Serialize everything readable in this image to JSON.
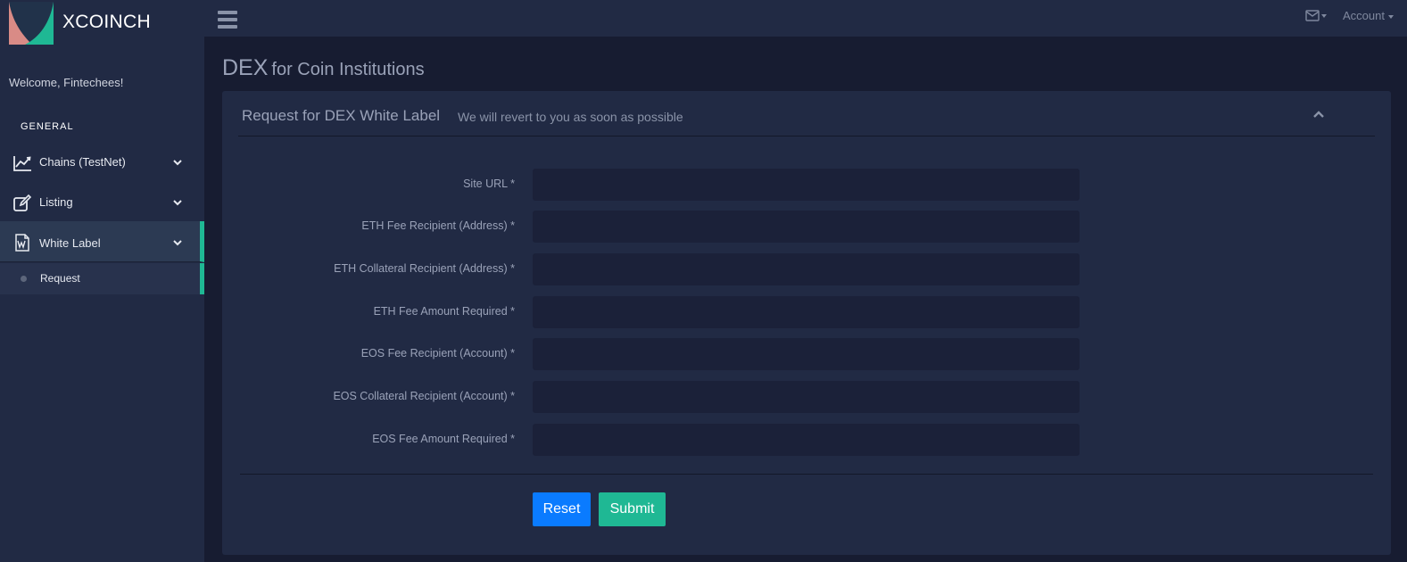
{
  "brand": {
    "name": "XCOINCH",
    "colors": {
      "pink": "#d98b86",
      "teal": "#1fb894",
      "dark": "#21324a"
    }
  },
  "sidebar": {
    "welcome": "Welcome, Fintechees!",
    "section_title": "GENERAL",
    "items": [
      {
        "label": "Chains (TestNet)",
        "icon": "line-chart-icon"
      },
      {
        "label": "Listing",
        "icon": "edit-icon"
      },
      {
        "label": "White Label",
        "icon": "word-document-icon",
        "active": true,
        "children": [
          {
            "label": "Request"
          }
        ]
      }
    ],
    "accent_color": "#1fb894"
  },
  "topbar": {
    "menu_icon": "hamburger-icon",
    "mail_icon": "envelope-icon",
    "account_label": "Account"
  },
  "page": {
    "title_main": "DEX",
    "title_sub": "for Coin Institutions"
  },
  "panel": {
    "title": "Request for DEX White Label",
    "subtitle": "We will revert to you as soon as possible",
    "collapse_icon": "chevron-up-icon",
    "fields": [
      {
        "label": "Site URL *",
        "value": ""
      },
      {
        "label": "ETH Fee Recipient (Address) *",
        "value": ""
      },
      {
        "label": "ETH Collateral Recipient (Address) *",
        "value": ""
      },
      {
        "label": "ETH Fee Amount Required *",
        "value": ""
      },
      {
        "label": "EOS Fee Recipient (Account) *",
        "value": ""
      },
      {
        "label": "EOS Collateral Recipient (Account) *",
        "value": ""
      },
      {
        "label": "EOS Fee Amount Required *",
        "value": ""
      }
    ],
    "buttons": {
      "reset": "Reset",
      "submit": "Submit"
    },
    "button_colors": {
      "reset": "#0a7bff",
      "submit": "#1fb894"
    }
  }
}
